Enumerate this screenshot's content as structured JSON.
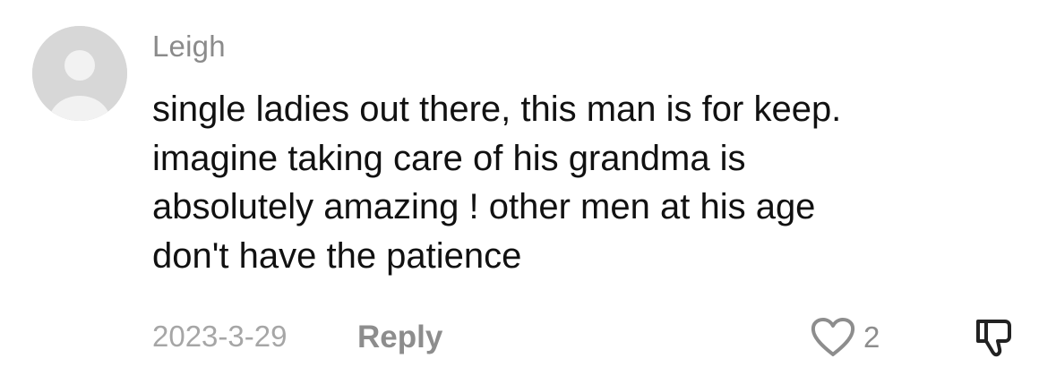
{
  "comment": {
    "author": "Leigh",
    "avatar_icon": "default-avatar-icon",
    "text_lines": [
      "single ladies out there, this man is for keep.",
      "imagine taking care of his grandma is",
      "absolutely amazing ! other men at his age",
      "don't have the patience"
    ],
    "date": "2023-3-29",
    "reply_label": "Reply",
    "like_icon": "heart-outline-icon",
    "like_count": "2",
    "dislike_icon": "thumbs-down-icon"
  },
  "colors": {
    "author": "#8b8b8b",
    "text": "#111111",
    "meta": "#a6a6a6",
    "action": "#8d8d8d",
    "avatar_bg": "#d7d7d7"
  }
}
